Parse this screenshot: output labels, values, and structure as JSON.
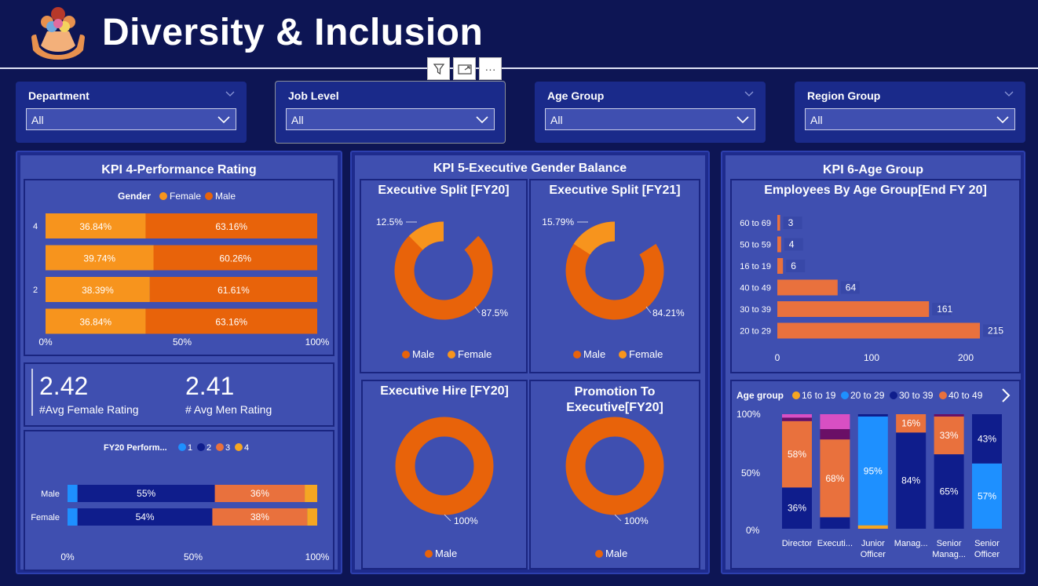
{
  "header": {
    "title": "Diversity & Inclusion",
    "logo_icon": "people-hands-icon"
  },
  "visual_header": {
    "filter_icon": "filter-icon",
    "focus_icon": "focus-mode-icon",
    "more_label": "···"
  },
  "slicers": [
    {
      "title": "Department",
      "value": "All"
    },
    {
      "title": "Job Level",
      "value": "All"
    },
    {
      "title": "Age Group",
      "value": "All"
    },
    {
      "title": "Region Group",
      "value": "All"
    }
  ],
  "kpi4": {
    "title": "KPI 4-Performance Rating",
    "legend_title": "Gender",
    "legend": [
      "Female",
      "Male"
    ],
    "bars": [
      {
        "label": "4",
        "female": "36.84%",
        "male": "63.16%",
        "f": 36.84
      },
      {
        "label": "",
        "female": "39.74%",
        "male": "60.26%",
        "f": 39.74
      },
      {
        "label": "2",
        "female": "38.39%",
        "male": "61.61%",
        "f": 38.39
      },
      {
        "label": "",
        "female": "36.84%",
        "male": "63.16%",
        "f": 36.84
      }
    ],
    "xticks": [
      "0%",
      "50%",
      "100%"
    ],
    "avg_female_value": "2.42",
    "avg_female_label": "#Avg Female Rating",
    "avg_men_value": "2.41",
    "avg_men_label": "# Avg Men Rating",
    "fy20": {
      "legend_title": "FY20 Perform...",
      "legend": [
        "1",
        "2",
        "3",
        "4"
      ],
      "rows": [
        {
          "label": "Male",
          "segments": [
            4,
            55,
            36,
            5
          ],
          "labels": [
            "55%",
            "36%"
          ]
        },
        {
          "label": "Female",
          "segments": [
            4,
            54,
            38,
            4
          ],
          "labels": [
            "54%",
            "38%"
          ]
        }
      ],
      "xticks": [
        "0%",
        "50%",
        "100%"
      ]
    }
  },
  "kpi5": {
    "title": "KPI 5-Executive Gender Balance",
    "donuts": [
      {
        "title": "Executive Split [FY20]",
        "small_label": "12.5%",
        "big_label": "87.5%",
        "female": 12.5,
        "legend": [
          "Male",
          "Female"
        ]
      },
      {
        "title": "Executive Split [FY21]",
        "small_label": "15.79%",
        "big_label": "84.21%",
        "female": 15.79,
        "legend": [
          "Male",
          "Female"
        ]
      },
      {
        "title": "Executive Hire [FY20]",
        "big_label": "100%",
        "female": 0,
        "legend": [
          "Male"
        ]
      },
      {
        "title_line1": "Promotion To",
        "title_line2": "Executive[FY20]",
        "big_label": "100%",
        "female": 0,
        "legend": [
          "Male"
        ]
      }
    ]
  },
  "kpi6": {
    "title": "KPI 6-Age Group",
    "bar_title": "Employees By Age Group[End FY 20]",
    "age_bars": [
      {
        "label": "60 to 69",
        "value": 3
      },
      {
        "label": "50 to 59",
        "value": 4
      },
      {
        "label": "16 to 19",
        "value": 6
      },
      {
        "label": "40 to 49",
        "value": 64
      },
      {
        "label": "30 to 39",
        "value": 161
      },
      {
        "label": "20 to 29",
        "value": 215
      }
    ],
    "age_xticks": [
      "0",
      "100",
      "200"
    ],
    "stack_legend_title": "Age group",
    "stack_legend": [
      "16 to 19",
      "20 to 29",
      "30 to 39",
      "40 to 49"
    ],
    "stack_yticks": [
      "100%",
      "50%",
      "0%"
    ],
    "stack_cols": [
      {
        "label1": "Director",
        "label2": "",
        "segments": [
          [
            "#0f1d8c",
            36
          ],
          [
            "#e9713d",
            58
          ],
          [
            "#6a0f66",
            3
          ],
          [
            "#d84fc3",
            3
          ]
        ],
        "labels": [
          [
            "36%",
            0
          ],
          [
            "58%",
            1
          ]
        ]
      },
      {
        "label1": "Executi...",
        "label2": "",
        "segments": [
          [
            "#0f1d8c",
            10
          ],
          [
            "#e9713d",
            68
          ],
          [
            "#6a0f66",
            9
          ],
          [
            "#d84fc3",
            13
          ]
        ],
        "labels": [
          [
            "68%",
            1
          ]
        ]
      },
      {
        "label1": "Junior",
        "label2": "Officer",
        "segments": [
          [
            "#f5a623",
            3
          ],
          [
            "#1e90ff",
            95
          ],
          [
            "#0f1d8c",
            2
          ]
        ],
        "labels": [
          [
            "95%",
            1
          ]
        ]
      },
      {
        "label1": "Manag...",
        "label2": "",
        "segments": [
          [
            "#0f1d8c",
            84
          ],
          [
            "#e9713d",
            16
          ]
        ],
        "labels": [
          [
            "84%",
            0
          ],
          [
            "16%",
            1
          ]
        ]
      },
      {
        "label1": "Senior",
        "label2": "Manag...",
        "segments": [
          [
            "#0f1d8c",
            65
          ],
          [
            "#e9713d",
            33
          ],
          [
            "#6a0f66",
            2
          ]
        ],
        "labels": [
          [
            "65%",
            0
          ],
          [
            "33%",
            1
          ]
        ]
      },
      {
        "label1": "Senior",
        "label2": "Officer",
        "segments": [
          [
            "#1e90ff",
            57
          ],
          [
            "#0f1d8c",
            43
          ]
        ],
        "labels": [
          [
            "57%",
            0
          ],
          [
            "43%",
            1
          ]
        ]
      }
    ]
  },
  "colors": {
    "female": "#f7941d",
    "male": "#e8630a",
    "perf1": "#1e90ff",
    "perf2": "#0f1d8c",
    "perf3": "#e9713d",
    "perf4": "#f5a623",
    "age_bar": "#e9713d"
  }
}
